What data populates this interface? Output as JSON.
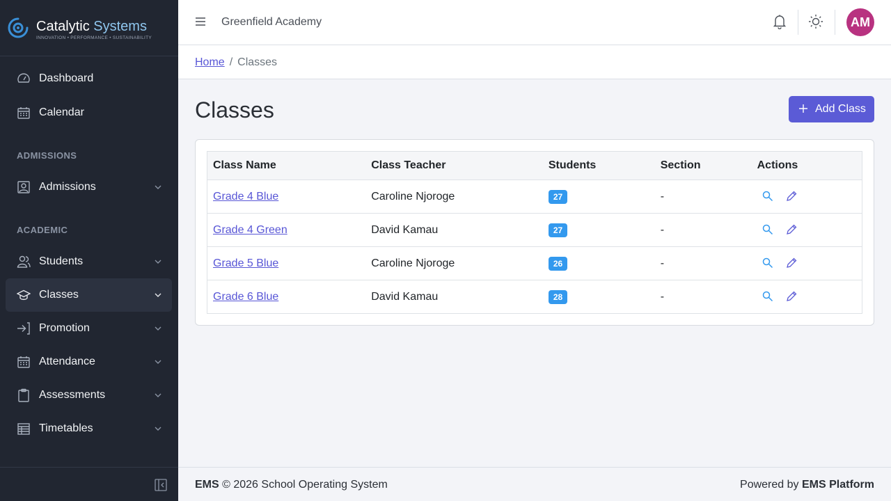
{
  "brand": {
    "name_part1": "Catalytic",
    "name_part2": "Systems",
    "tagline": "INNOVATION • PERFORMANCE • SUSTAINABILITY"
  },
  "sidebar": {
    "items": [
      {
        "label": "Dashboard",
        "icon": "speedometer-icon"
      },
      {
        "label": "Calendar",
        "icon": "calendar-icon"
      },
      {
        "label": "Admissions",
        "icon": "id-card-icon"
      },
      {
        "label": "Students",
        "icon": "users-icon"
      },
      {
        "label": "Classes",
        "icon": "graduation-cap-icon"
      },
      {
        "label": "Promotion",
        "icon": "arrow-right-to-bracket-icon"
      },
      {
        "label": "Attendance",
        "icon": "calendar-grid-icon"
      },
      {
        "label": "Assessments",
        "icon": "clipboard-icon"
      },
      {
        "label": "Timetables",
        "icon": "table-icon"
      }
    ],
    "sections": {
      "admissions": "ADMISSIONS",
      "academic": "ACADEMIC"
    },
    "active": "Classes"
  },
  "header": {
    "school_name": "Greenfield Academy",
    "avatar_initials": "AM"
  },
  "breadcrumb": {
    "home": "Home",
    "separator": "/",
    "current": "Classes"
  },
  "main": {
    "title": "Classes",
    "add_button": "Add Class",
    "table": {
      "headers": [
        "Class Name",
        "Class Teacher",
        "Students",
        "Section",
        "Actions"
      ],
      "rows": [
        {
          "name": "Grade 4 Blue",
          "teacher": "Caroline Njoroge",
          "students": "27",
          "section": "-"
        },
        {
          "name": "Grade 4 Green",
          "teacher": "David Kamau",
          "students": "27",
          "section": "-"
        },
        {
          "name": "Grade 5 Blue",
          "teacher": "Caroline Njoroge",
          "students": "26",
          "section": "-"
        },
        {
          "name": "Grade 6 Blue",
          "teacher": "David Kamau",
          "students": "28",
          "section": "-"
        }
      ]
    }
  },
  "footer": {
    "brand": "EMS",
    "copyright": "© 2026 School Operating System",
    "powered_prefix": "Powered by",
    "powered_brand": "EMS Platform"
  },
  "colors": {
    "sidebar_bg": "#212631",
    "accent": "#5b5bd6",
    "badge": "#3399ee",
    "avatar": "#b83280",
    "brand_blue": "#8fc6ee"
  }
}
